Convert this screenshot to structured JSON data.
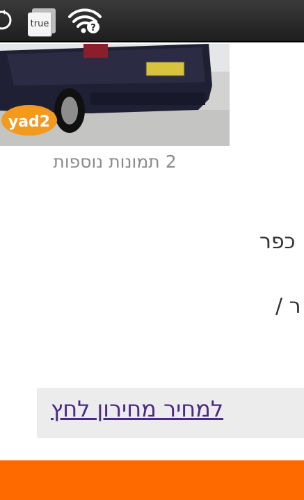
{
  "status_bar": {
    "icons": [
      "sync-icon",
      "app-notification-icon",
      "wifi-question-icon"
    ],
    "app_icon_label": "true"
  },
  "listing": {
    "photo_logo_text": "yad2",
    "more_photos_label": "2 תמונות נוספות",
    "detail_line_1": "כפר",
    "detail_line_2": "ר /"
  },
  "price_link": {
    "label": "למחיר מחירון לחץ"
  },
  "colors": {
    "status_bar": "#2a2a2a",
    "link": "#4b2a86",
    "footer_bar": "#ff6a00",
    "link_box": "#ececec"
  }
}
